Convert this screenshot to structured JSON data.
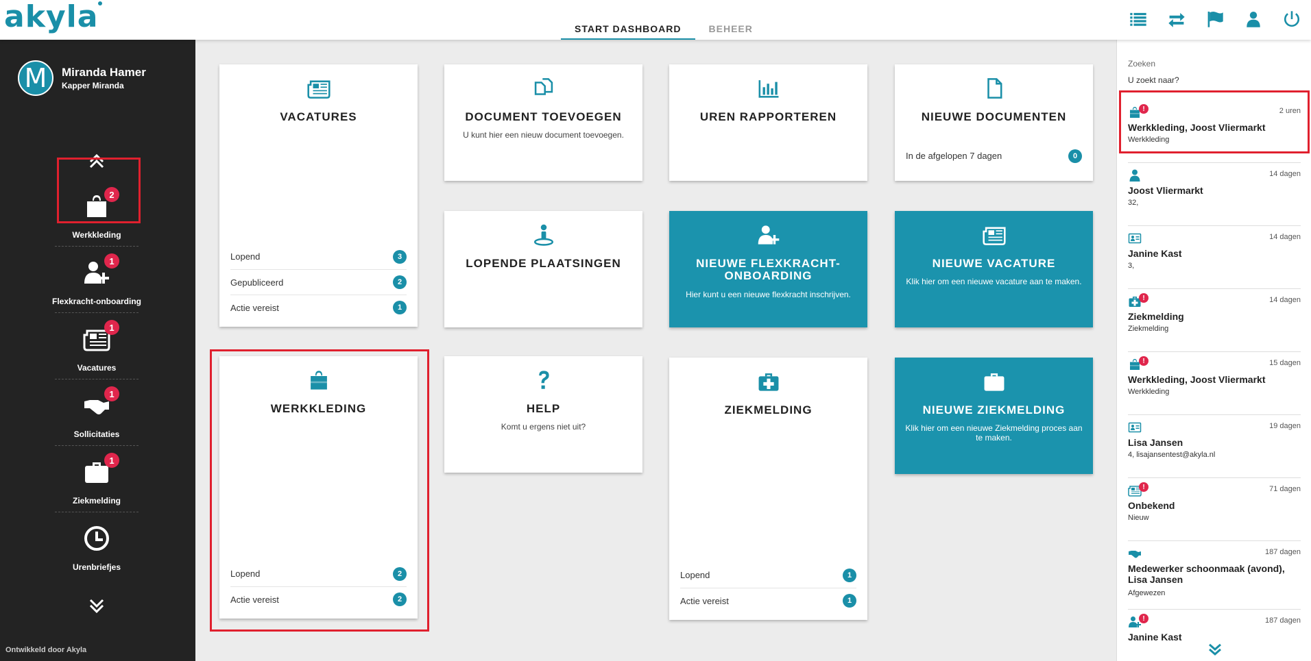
{
  "app": {
    "logo": "akyla"
  },
  "topnav": {
    "tabs": [
      {
        "label": "START DASHBOARD"
      },
      {
        "label": "BEHEER"
      }
    ]
  },
  "topicons": [
    "list-icon",
    "transfer-icon",
    "flag-icon",
    "user-icon",
    "power-icon"
  ],
  "user": {
    "initial": "M",
    "name": "Miranda Hamer",
    "company": "Kapper Miranda"
  },
  "sidebar": {
    "items": [
      {
        "label": "Werkkleding",
        "badge": "2",
        "icon": "shopping-bag-icon"
      },
      {
        "label": "Flexkracht-onboarding",
        "badge": "1",
        "icon": "user-plus-icon"
      },
      {
        "label": "Vacatures",
        "badge": "1",
        "icon": "newspaper-icon"
      },
      {
        "label": "Sollicitaties",
        "badge": "1",
        "icon": "handshake-icon"
      },
      {
        "label": "Ziekmelding",
        "badge": "1",
        "icon": "medkit-icon"
      },
      {
        "label": "Urenbriefjes",
        "badge": "",
        "icon": "clock-icon"
      }
    ],
    "footer": "Ontwikkeld door Akyla"
  },
  "cards": {
    "vacatures": {
      "title": "VACATURES",
      "rows": [
        {
          "label": "Lopend",
          "count": "3"
        },
        {
          "label": "Gepubliceerd",
          "count": "2"
        },
        {
          "label": "Actie vereist",
          "count": "1"
        }
      ]
    },
    "document": {
      "title": "DOCUMENT TOEVOEGEN",
      "sub": "U kunt hier een nieuw document toevoegen."
    },
    "uren": {
      "title": "UREN RAPPORTEREN"
    },
    "nieuwe_documenten": {
      "title": "NIEUWE DOCUMENTEN",
      "rows": [
        {
          "label": "In de afgelopen 7 dagen",
          "count": "0"
        }
      ]
    },
    "plaatsingen": {
      "title": "LOPENDE PLAATSINGEN"
    },
    "flexkracht": {
      "title": "NIEUWE FLEXKRACHT-ONBOARDING",
      "sub": "Hier kunt u een nieuwe flexkracht inschrijven."
    },
    "nieuwe_vacature": {
      "title": "NIEUWE VACATURE",
      "sub": "Klik hier om een nieuwe vacature aan te maken."
    },
    "werkkleding": {
      "title": "WERKKLEDING",
      "rows": [
        {
          "label": "Lopend",
          "count": "2"
        },
        {
          "label": "Actie vereist",
          "count": "2"
        }
      ]
    },
    "help": {
      "title": "HELP",
      "sub": "Komt u ergens niet uit?"
    },
    "ziekmelding": {
      "title": "ZIEKMELDING",
      "rows": [
        {
          "label": "Lopend",
          "count": "1"
        },
        {
          "label": "Actie vereist",
          "count": "1"
        }
      ]
    },
    "nieuwe_ziekmelding": {
      "title": "NIEUWE ZIEKMELDING",
      "sub": "Klik hier om een nieuwe Ziekmelding proces aan te maken."
    }
  },
  "feed": {
    "search_label": "Zoeken",
    "search_placeholder": "U zoekt naar?",
    "items": [
      {
        "icon": "shopping-bag-icon",
        "alert": true,
        "time": "2 uren",
        "title": "Werkkleding, Joost Vliermarkt",
        "sub": "Werkkleding"
      },
      {
        "icon": "user-icon",
        "alert": false,
        "time": "14 dagen",
        "title": "Joost Vliermarkt",
        "sub": "32,"
      },
      {
        "icon": "id-card-icon",
        "alert": false,
        "time": "14 dagen",
        "title": "Janine Kast",
        "sub": "3,"
      },
      {
        "icon": "medkit-icon",
        "alert": true,
        "time": "14 dagen",
        "title": "Ziekmelding",
        "sub": "Ziekmelding"
      },
      {
        "icon": "shopping-bag-icon",
        "alert": true,
        "time": "15 dagen",
        "title": "Werkkleding, Joost Vliermarkt",
        "sub": "Werkkleding"
      },
      {
        "icon": "id-card-icon",
        "alert": false,
        "time": "19 dagen",
        "title": "Lisa Jansen",
        "sub": "4, lisajansentest@akyla.nl"
      },
      {
        "icon": "newspaper-icon",
        "alert": true,
        "time": "71 dagen",
        "title": "Onbekend",
        "sub": "Nieuw"
      },
      {
        "icon": "handshake-icon",
        "alert": false,
        "time": "187 dagen",
        "title": "Medewerker schoonmaak (avond), Lisa Jansen",
        "sub": "Afgewezen"
      },
      {
        "icon": "user-plus-icon",
        "alert": true,
        "time": "187 dagen",
        "title": "Janine Kast",
        "sub": ""
      }
    ]
  },
  "colors": {
    "accent": "#1a8fa8",
    "badge": "#e0264c",
    "sidebar": "#232323",
    "highlight": "#e0202e"
  }
}
